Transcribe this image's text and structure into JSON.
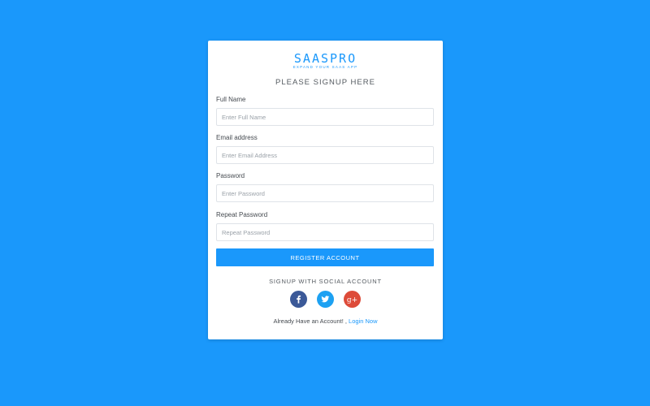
{
  "brand": {
    "name": "SAASPRO",
    "tagline": "EXPAND YOUR SAAS APP"
  },
  "form": {
    "heading": "PLEASE SIGNUP HERE",
    "full_name": {
      "label": "Full Name",
      "placeholder": "Enter Full Name"
    },
    "email": {
      "label": "Email address",
      "placeholder": "Enter Email Address"
    },
    "password": {
      "label": "Password",
      "placeholder": "Enter Password"
    },
    "repeat_password": {
      "label": "Repeat Password",
      "placeholder": "Repeat Password"
    },
    "submit_label": "REGISTER ACCOUNT"
  },
  "social": {
    "heading": "SIGNUP WITH SOCIAL ACCOUNT",
    "buttons": [
      {
        "icon": "facebook-icon",
        "color": "#3b5998"
      },
      {
        "icon": "twitter-icon",
        "color": "#1da1f2"
      },
      {
        "icon": "google-plus-icon",
        "color": "#dd4b39"
      }
    ]
  },
  "footer": {
    "text": "Already Have an Account! ,",
    "link_label": "Login Now"
  },
  "colors": {
    "background": "#1a98fb",
    "accent": "#1a98fb",
    "card": "#ffffff"
  }
}
